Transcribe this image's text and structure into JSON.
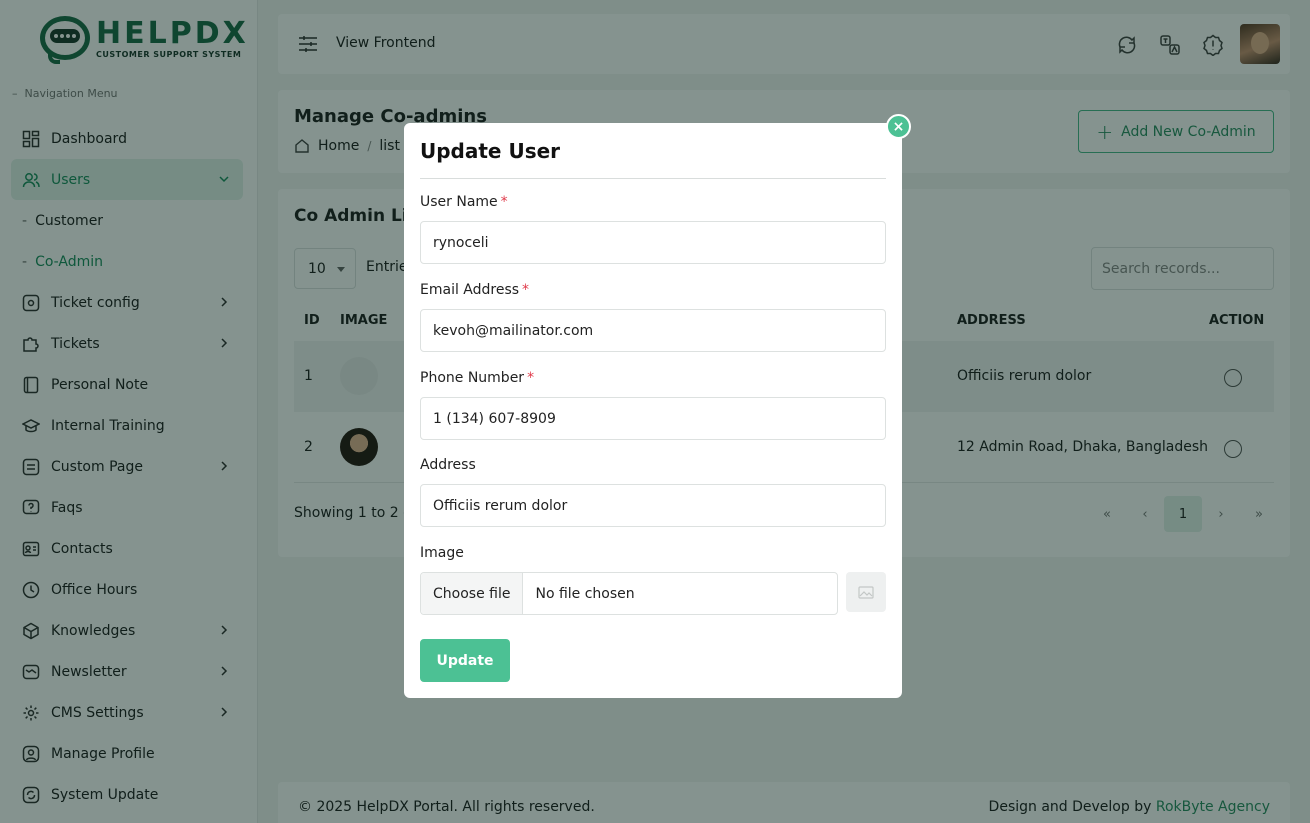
{
  "brand": {
    "name": "HELPDX",
    "tagline": "CUSTOMER SUPPORT SYSTEM"
  },
  "sidebar": {
    "heading": "Navigation Menu",
    "items": [
      {
        "label": "Dashboard",
        "icon": "grid-icon"
      },
      {
        "label": "Users",
        "icon": "users-icon"
      },
      {
        "label": "Customer"
      },
      {
        "label": "Co-Admin"
      },
      {
        "label": "Ticket config",
        "icon": "gear-network-icon"
      },
      {
        "label": "Tickets",
        "icon": "puzzle-icon"
      },
      {
        "label": "Personal Note",
        "icon": "note-icon"
      },
      {
        "label": "Internal Training",
        "icon": "graduation-cap-icon"
      },
      {
        "label": "Custom Page",
        "icon": "page-icon"
      },
      {
        "label": "Faqs",
        "icon": "question-bubble-icon"
      },
      {
        "label": "Contacts",
        "icon": "contact-card-icon"
      },
      {
        "label": "Office Hours",
        "icon": "clock-icon"
      },
      {
        "label": "Knowledges",
        "icon": "cube-icon"
      },
      {
        "label": "Newsletter",
        "icon": "newsletter-icon"
      },
      {
        "label": "CMS Settings",
        "icon": "settings-icon"
      },
      {
        "label": "Manage Profile",
        "icon": "user-circle-icon"
      },
      {
        "label": "System Update",
        "icon": "refresh-icon"
      }
    ]
  },
  "topbar": {
    "view_frontend": "View Frontend"
  },
  "page": {
    "title": "Manage Co-admins",
    "breadcrumb": [
      "Home",
      "list"
    ],
    "add_button": "Add New Co-Admin"
  },
  "list": {
    "title": "Co Admin Lis",
    "entries_value": "10",
    "entries_label": "Entrie",
    "search_placeholder": "Search records...",
    "columns": {
      "id": "ID",
      "image": "IMAGE",
      "address": "ADDRESS",
      "action": "ACTION"
    },
    "rows": [
      {
        "id": "1",
        "address": "Officiis rerum dolor"
      },
      {
        "id": "2",
        "address": "12 Admin Road, Dhaka, Bangladesh"
      }
    ],
    "showing": "Showing 1 to 2 o",
    "pager": [
      "«",
      "‹",
      "1",
      "›",
      "»"
    ]
  },
  "footer": {
    "copyright": "© 2025 HelpDX Portal. All rights reserved.",
    "credit_prefix": "Design and Develop by",
    "credit_link": "RokByte Agency"
  },
  "modal": {
    "title": "Update User",
    "close": "×",
    "fields": {
      "username_label": "User Name",
      "username_value": "rynoceli",
      "email_label": "Email Address",
      "email_value": "kevoh@mailinator.com",
      "phone_label": "Phone Number",
      "phone_value": "1 (134) 607-8909",
      "address_label": "Address",
      "address_value": "Officiis rerum dolor",
      "image_label": "Image",
      "file_button": "Choose file",
      "file_text": "No file chosen",
      "required_mark": "*"
    },
    "submit": "Update"
  },
  "colors": {
    "accent": "#4cc194",
    "active_text": "#1e8f60",
    "required": "#e03a4a"
  }
}
